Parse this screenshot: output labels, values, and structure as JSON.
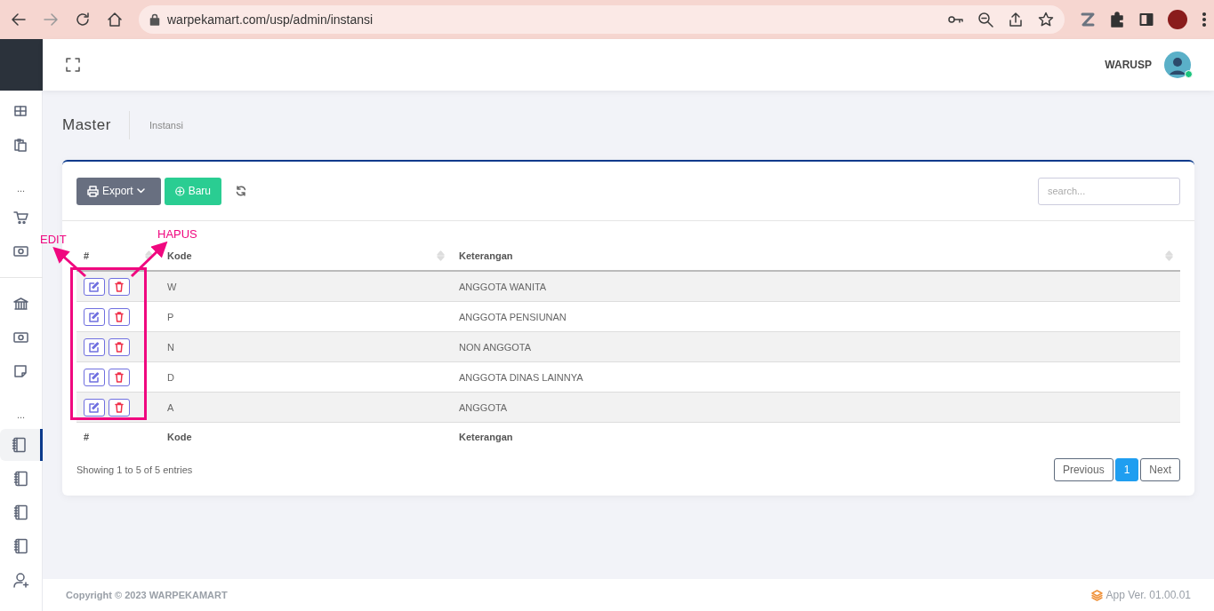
{
  "browser": {
    "url": "warpekamart.com/usp/admin/instansi"
  },
  "topbar": {
    "user": "WARUSP",
    "online": true
  },
  "sidebar": {
    "items": [
      {
        "kind": "grid",
        "selected": false
      },
      {
        "kind": "clipboard",
        "selected": false
      },
      {
        "kind": "more",
        "label": "..."
      },
      {
        "kind": "cart",
        "selected": false
      },
      {
        "kind": "cash",
        "selected": false
      },
      {
        "kind": "divider"
      },
      {
        "kind": "bank",
        "selected": false
      },
      {
        "kind": "cash",
        "selected": false
      },
      {
        "kind": "note",
        "selected": false
      },
      {
        "kind": "more",
        "label": "..."
      },
      {
        "kind": "book",
        "selected": true
      },
      {
        "kind": "book",
        "selected": false
      },
      {
        "kind": "book",
        "selected": false
      },
      {
        "kind": "book",
        "selected": false
      },
      {
        "kind": "user-add",
        "selected": false
      }
    ]
  },
  "breadcrumb": {
    "title": "Master",
    "page": "Instansi"
  },
  "toolbar": {
    "buttons": [
      {
        "kind": "export",
        "label": "Export"
      },
      {
        "kind": "new",
        "label": "Baru"
      }
    ],
    "search": {
      "placeholder": "search..."
    }
  },
  "table": {
    "columns": [
      "#",
      "Kode",
      "Keterangan"
    ],
    "rows": [
      {
        "kode": "W",
        "keterangan": "ANGGOTA WANITA"
      },
      {
        "kode": "P",
        "keterangan": "ANGGOTA PENSIUNAN"
      },
      {
        "kode": "N",
        "keterangan": "NON ANGGOTA"
      },
      {
        "kode": "D",
        "keterangan": "ANGGOTA DINAS LAINNYA"
      },
      {
        "kode": "A",
        "keterangan": "ANGGOTA"
      }
    ],
    "footer_columns": [
      "#",
      "Kode",
      "Keterangan"
    ]
  },
  "info": "Showing 1 to 5 of 5 entries",
  "pagination": [
    {
      "label": "Previous",
      "selected": false
    },
    {
      "label": "1",
      "selected": true
    },
    {
      "label": "Next",
      "selected": false
    }
  ],
  "footer": {
    "copyright": "Copyright © 2023 WARPEKAMART",
    "version": "App Ver. 01.00.01"
  },
  "annotations": [
    {
      "label": "EDIT"
    },
    {
      "label": "HAPUS"
    }
  ]
}
